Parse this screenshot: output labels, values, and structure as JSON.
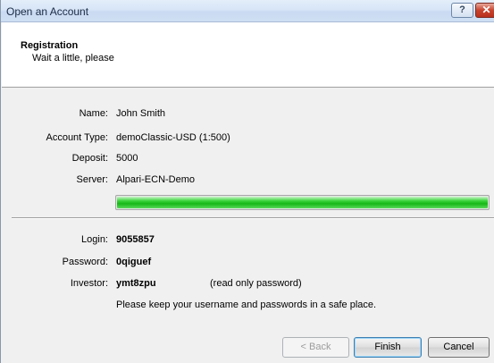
{
  "window": {
    "title": "Open an Account",
    "help_glyph": "?",
    "close_glyph": "✕"
  },
  "header": {
    "title": "Registration",
    "subtitle": "Wait a little, please"
  },
  "info": {
    "name_label": "Name:",
    "name_value": "John Smith",
    "account_type_label": "Account Type:",
    "account_type_value": "demoClassic-USD (1:500)",
    "deposit_label": "Deposit:",
    "deposit_value": "5000",
    "server_label": "Server:",
    "server_value": "Alpari-ECN-Demo"
  },
  "progress": {
    "percent": 100,
    "color": "#17b817"
  },
  "credentials": {
    "login_label": "Login:",
    "login_value": "9055857",
    "password_label": "Password:",
    "password_value": "0qiguef",
    "investor_label": "Investor:",
    "investor_value": "ymt8zpu",
    "investor_note": "(read only password)",
    "notice": "Please keep your username and passwords in a safe place."
  },
  "buttons": {
    "back": "< Back",
    "finish": "Finish",
    "cancel": "Cancel"
  }
}
